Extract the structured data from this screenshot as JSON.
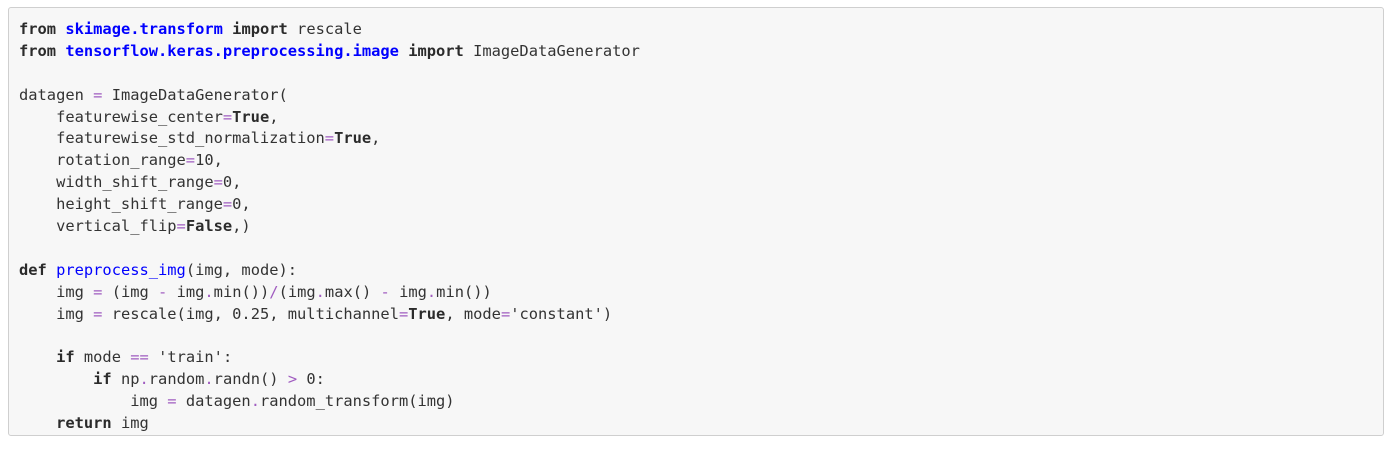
{
  "code_cell": {
    "lines": [
      [
        [
          "kw",
          "from"
        ],
        [
          "t",
          " "
        ],
        [
          "ns",
          "skimage.transform"
        ],
        [
          "t",
          " "
        ],
        [
          "kw",
          "import"
        ],
        [
          "t",
          " rescale"
        ]
      ],
      [
        [
          "kw",
          "from"
        ],
        [
          "t",
          " "
        ],
        [
          "ns",
          "tensorflow.keras.preprocessing.image"
        ],
        [
          "t",
          " "
        ],
        [
          "kw",
          "import"
        ],
        [
          "t",
          " ImageDataGenerator"
        ]
      ],
      [],
      [
        [
          "t",
          "datagen "
        ],
        [
          "op",
          "="
        ],
        [
          "t",
          " ImageDataGenerator("
        ]
      ],
      [
        [
          "t",
          "    featurewise_center"
        ],
        [
          "op",
          "="
        ],
        [
          "kw",
          "True"
        ],
        [
          "t",
          ","
        ]
      ],
      [
        [
          "t",
          "    featurewise_std_normalization"
        ],
        [
          "op",
          "="
        ],
        [
          "kw",
          "True"
        ],
        [
          "t",
          ","
        ]
      ],
      [
        [
          "t",
          "    rotation_range"
        ],
        [
          "op",
          "="
        ],
        [
          "num",
          "10"
        ],
        [
          "t",
          ","
        ]
      ],
      [
        [
          "t",
          "    width_shift_range"
        ],
        [
          "op",
          "="
        ],
        [
          "num",
          "0"
        ],
        [
          "t",
          ","
        ]
      ],
      [
        [
          "t",
          "    height_shift_range"
        ],
        [
          "op",
          "="
        ],
        [
          "num",
          "0"
        ],
        [
          "t",
          ","
        ]
      ],
      [
        [
          "t",
          "    vertical_flip"
        ],
        [
          "op",
          "="
        ],
        [
          "kw",
          "False"
        ],
        [
          "t",
          ",)"
        ]
      ],
      [],
      [
        [
          "kw",
          "def"
        ],
        [
          "t",
          " "
        ],
        [
          "fn",
          "preprocess_img"
        ],
        [
          "t",
          "(img, mode):"
        ]
      ],
      [
        [
          "t",
          "    img "
        ],
        [
          "op",
          "="
        ],
        [
          "t",
          " (img "
        ],
        [
          "op",
          "-"
        ],
        [
          "t",
          " img"
        ],
        [
          "op",
          "."
        ],
        [
          "t",
          "min())"
        ],
        [
          "op",
          "/"
        ],
        [
          "t",
          "(img"
        ],
        [
          "op",
          "."
        ],
        [
          "t",
          "max() "
        ],
        [
          "op",
          "-"
        ],
        [
          "t",
          " img"
        ],
        [
          "op",
          "."
        ],
        [
          "t",
          "min())"
        ]
      ],
      [
        [
          "t",
          "    img "
        ],
        [
          "op",
          "="
        ],
        [
          "t",
          " rescale(img, "
        ],
        [
          "num",
          "0.25"
        ],
        [
          "t",
          ", multichannel"
        ],
        [
          "op",
          "="
        ],
        [
          "kw",
          "True"
        ],
        [
          "t",
          ", mode"
        ],
        [
          "op",
          "="
        ],
        [
          "str",
          "'constant'"
        ],
        [
          "t",
          ")"
        ]
      ],
      [],
      [
        [
          "t",
          "    "
        ],
        [
          "kw",
          "if"
        ],
        [
          "t",
          " mode "
        ],
        [
          "op",
          "=="
        ],
        [
          "t",
          " "
        ],
        [
          "str",
          "'train'"
        ],
        [
          "t",
          ":"
        ]
      ],
      [
        [
          "t",
          "        "
        ],
        [
          "kw",
          "if"
        ],
        [
          "t",
          " np"
        ],
        [
          "op",
          "."
        ],
        [
          "t",
          "random"
        ],
        [
          "op",
          "."
        ],
        [
          "t",
          "randn() "
        ],
        [
          "op",
          ">"
        ],
        [
          "t",
          " "
        ],
        [
          "num",
          "0"
        ],
        [
          "t",
          ":"
        ]
      ],
      [
        [
          "t",
          "            img "
        ],
        [
          "op",
          "="
        ],
        [
          "t",
          " datagen"
        ],
        [
          "op",
          "."
        ],
        [
          "t",
          "random_transform(img)"
        ]
      ],
      [
        [
          "t",
          "    "
        ],
        [
          "kw",
          "return"
        ],
        [
          "t",
          " img"
        ]
      ]
    ]
  }
}
